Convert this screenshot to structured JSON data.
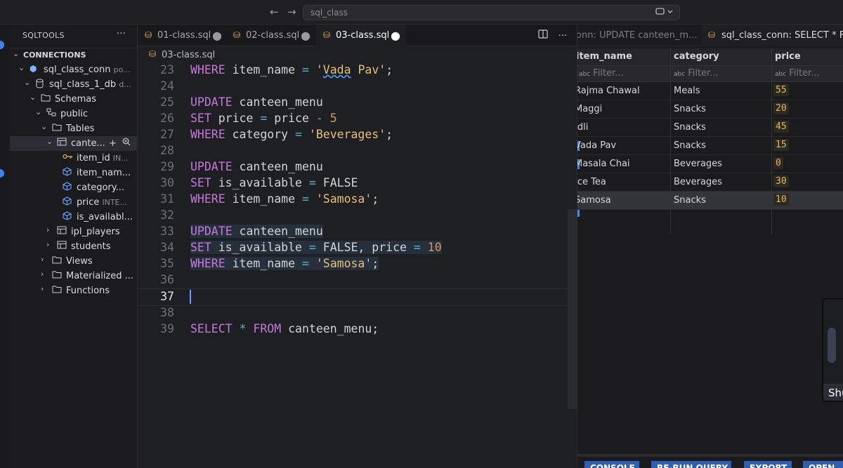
{
  "titlebar": {
    "search_text": "sql_class",
    "back_icon": "←",
    "forward_icon": "→"
  },
  "sidebar": {
    "title": "SQLTOOLS",
    "more": "···",
    "section": "CONNECTIONS",
    "tree": [
      {
        "label": "sql_class_conn",
        "sub": "po..."
      },
      {
        "label": "sql_class_1_db",
        "sub": "d..."
      },
      {
        "label": "Schemas"
      },
      {
        "label": "public"
      },
      {
        "label": "Tables"
      },
      {
        "label": "cante..."
      },
      {
        "label": "item_id",
        "sub": "IN..."
      },
      {
        "label": "item_nam..."
      },
      {
        "label": "category..."
      },
      {
        "label": "price",
        "sub": "INTE..."
      },
      {
        "label": "is_availabl..."
      },
      {
        "label": "ipl_players"
      },
      {
        "label": "students"
      },
      {
        "label": "Views"
      },
      {
        "label": "Materialized ..."
      },
      {
        "label": "Functions"
      }
    ]
  },
  "editor": {
    "tabs": [
      {
        "label": "01-class.sql",
        "modified": "●"
      },
      {
        "label": "02-class.sql",
        "modified": "●"
      },
      {
        "label": "03-class.sql",
        "modified": "●"
      }
    ],
    "breadcrumb": "03-class.sql",
    "line_numbers": [
      "23",
      "24",
      "25",
      "26",
      "27",
      "28",
      "29",
      "30",
      "31",
      "32",
      "33",
      "34",
      "35",
      "36",
      "37",
      "38",
      "39"
    ]
  },
  "results": {
    "tabs": [
      {
        "label": "onn: UPDATE canteen_m..."
      },
      {
        "label": "sql_class_conn: SELECT * FRO"
      }
    ],
    "columns": [
      "item_name",
      "category",
      "price"
    ],
    "filter_placeholder": "Filter...",
    "filter_badge": "abc",
    "rows": [
      {
        "item_name": "Rajma Chawal",
        "category": "Meals",
        "price": "55"
      },
      {
        "item_name": "Maggi",
        "category": "Snacks",
        "price": "20"
      },
      {
        "item_name": "Idli",
        "category": "Snacks",
        "price": "45"
      },
      {
        "item_name": "Vada Pav",
        "category": "Snacks",
        "price": "15"
      },
      {
        "item_name": "Masala Chai",
        "category": "Beverages",
        "price": "0"
      },
      {
        "item_name": "Ice Tea",
        "category": "Beverages",
        "price": "30"
      },
      {
        "item_name": "Samosa",
        "category": "Snacks",
        "price": "10"
      }
    ],
    "buttons": [
      "CONSOLE",
      "RE-RUN QUERY",
      "EXPORT",
      "OPEN"
    ]
  },
  "webcam": {
    "label": "Shu"
  },
  "colors": {
    "accent": "#3b82f6",
    "keyword": "#c678dd",
    "string": "#e5c07b",
    "number": "#d19a66",
    "tab_icon": "#e6b34b"
  }
}
